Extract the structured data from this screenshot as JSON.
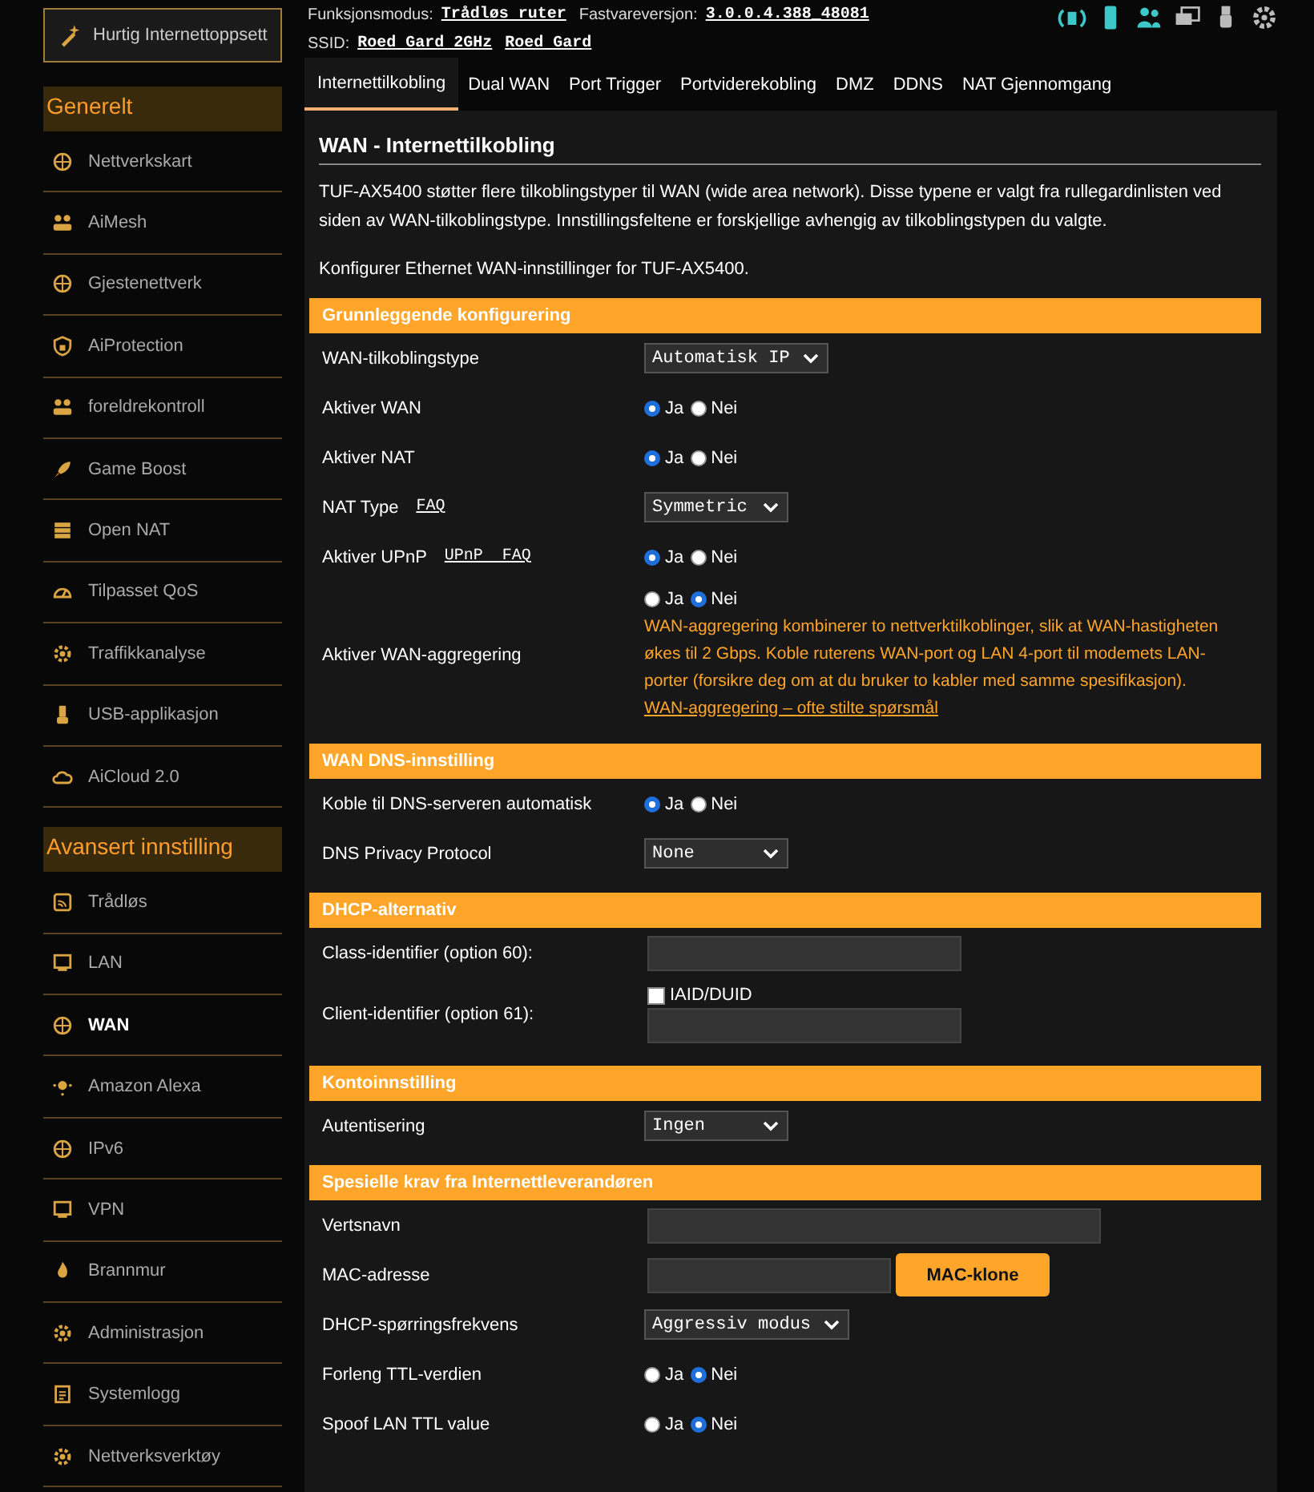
{
  "quick_setup": {
    "label": "Hurtig Internettoppsett"
  },
  "header": {
    "mode_label": "Funksjonsmodus:",
    "mode": "Trådløs ruter",
    "firmware_label": "Fastvareversjon:",
    "firmware": "3.0.0.4.388_48081",
    "ssid_label": "SSID:",
    "ssids": [
      "Roed Gard 2GHz",
      "Roed Gard"
    ]
  },
  "sidebar": [
    {
      "title": "Generelt",
      "items": [
        {
          "label": "Nettverkskart",
          "selected": false
        },
        {
          "label": "AiMesh",
          "selected": false
        },
        {
          "label": "Gjestenettverk",
          "selected": false
        },
        {
          "label": "AiProtection",
          "selected": false
        },
        {
          "label": "foreldrekontroll",
          "selected": false
        },
        {
          "label": "Game Boost",
          "selected": false
        },
        {
          "label": "Open NAT",
          "selected": false
        },
        {
          "label": "Tilpasset QoS",
          "selected": false
        },
        {
          "label": "Traffikkanalyse",
          "selected": false
        },
        {
          "label": "USB-applikasjon",
          "selected": false
        },
        {
          "label": "AiCloud 2.0",
          "selected": false
        }
      ]
    },
    {
      "title": "Avansert innstilling",
      "items": [
        {
          "label": "Trådløs",
          "selected": false
        },
        {
          "label": "LAN",
          "selected": false
        },
        {
          "label": "WAN",
          "selected": true
        },
        {
          "label": "Amazon Alexa",
          "selected": false
        },
        {
          "label": "IPv6",
          "selected": false
        },
        {
          "label": "VPN",
          "selected": false
        },
        {
          "label": "Brannmur",
          "selected": false
        },
        {
          "label": "Administrasjon",
          "selected": false
        },
        {
          "label": "Systemlogg",
          "selected": false
        },
        {
          "label": "Nettverksverktøy",
          "selected": false
        }
      ]
    }
  ],
  "tabs": [
    {
      "label": "Internettilkobling",
      "selected": true
    },
    {
      "label": "Dual WAN",
      "selected": false
    },
    {
      "label": "Port Trigger",
      "selected": false
    },
    {
      "label": "Portviderekobling",
      "selected": false
    },
    {
      "label": "DMZ",
      "selected": false
    },
    {
      "label": "DDNS",
      "selected": false
    },
    {
      "label": "NAT Gjennomgang",
      "selected": false
    }
  ],
  "page": {
    "title": "WAN - Internettilkobling",
    "description": "TUF-AX5400 støtter flere tilkoblingstyper til WAN (wide area network). Disse typene er valgt fra rullegardinlisten ved siden av WAN-tilkoblingstype. Innstillingsfeltene er forskjellige avhengig av tilkoblingstypen du valgte.",
    "subtitle": "Konfigurer Ethernet WAN-innstillinger for TUF-AX5400."
  },
  "sections": [
    {
      "title": "Grunnleggende konfigurering",
      "rows": [
        {
          "kind": "select",
          "label": "WAN-tilkoblingstype",
          "value": "Automatisk IP"
        },
        {
          "kind": "radio",
          "label": "Aktiver WAN",
          "options": [
            {
              "label": "Ja",
              "selected": true
            },
            {
              "label": "Nei",
              "selected": false
            }
          ]
        },
        {
          "kind": "radio",
          "label": "Aktiver NAT",
          "options": [
            {
              "label": "Ja",
              "selected": true
            },
            {
              "label": "Nei",
              "selected": false
            }
          ]
        },
        {
          "kind": "select",
          "label": "NAT Type",
          "link": "FAQ",
          "value": "Symmetric"
        },
        {
          "kind": "radio",
          "label": "Aktiver UPnP",
          "link": "UPnP  FAQ",
          "options": [
            {
              "label": "Ja",
              "selected": true
            },
            {
              "label": "Nei",
              "selected": false
            }
          ]
        },
        {
          "kind": "radio",
          "label": "Aktiver WAN-aggregering",
          "options": [
            {
              "label": "Ja",
              "selected": false
            },
            {
              "label": "Nei",
              "selected": true
            }
          ],
          "note": "WAN-aggregering kombinerer to nettverktilkoblinger, slik at WAN-hastigheten økes til 2 Gbps. Koble ruterens WAN-port og LAN 4-port til modemets LAN-porter (forsikre deg om at du bruker to kabler med samme spesifikasjon).",
          "note_link": "WAN-aggregering – ofte stilte spørsmål"
        }
      ]
    },
    {
      "title": "WAN DNS-innstilling",
      "rows": [
        {
          "kind": "radio",
          "label": "Koble til DNS-serveren automatisk",
          "options": [
            {
              "label": "Ja",
              "selected": true
            },
            {
              "label": "Nei",
              "selected": false
            }
          ]
        },
        {
          "kind": "select",
          "label": "DNS Privacy Protocol",
          "value": "None"
        }
      ]
    },
    {
      "title": "DHCP-alternativ",
      "rows": [
        {
          "kind": "input",
          "label": "Class-identifier (option 60):"
        },
        {
          "kind": "checkbox_input",
          "label": "Client-identifier (option 61):",
          "checkbox": {
            "label": "IAID/DUID",
            "checked": false
          }
        }
      ]
    },
    {
      "title": "Kontoinnstilling",
      "rows": [
        {
          "kind": "select",
          "label": "Autentisering",
          "value": "Ingen"
        }
      ]
    },
    {
      "title": "Spesielle krav fra Internettleverandøren",
      "rows": [
        {
          "kind": "input_long",
          "label": "Vertsnavn"
        },
        {
          "kind": "input_button",
          "label": "MAC-adresse",
          "button": "MAC-klone"
        },
        {
          "kind": "select",
          "label": "DHCP-spørringsfrekvens",
          "value": "Aggressiv modus"
        },
        {
          "kind": "radio",
          "label": "Forleng TTL-verdien",
          "options": [
            {
              "label": "Ja",
              "selected": false
            },
            {
              "label": "Nei",
              "selected": true
            }
          ]
        },
        {
          "kind": "radio",
          "label": "Spoof LAN TTL value",
          "options": [
            {
              "label": "Ja",
              "selected": false
            },
            {
              "label": "Nei",
              "selected": true
            }
          ]
        }
      ]
    }
  ]
}
